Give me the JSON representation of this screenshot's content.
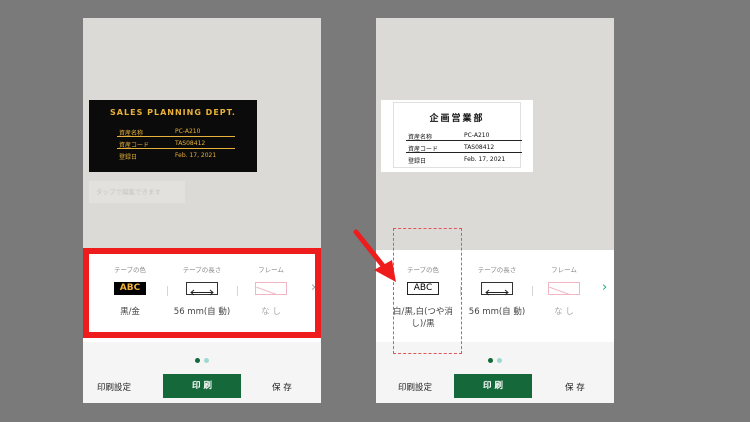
{
  "left": {
    "label": {
      "title": "SALES PLANNING DEPT.",
      "rows": [
        {
          "key": "資産名称",
          "value": "PC-A210"
        },
        {
          "key": "資産コード",
          "value": "TAS08412"
        },
        {
          "key": "登録日",
          "value": "Feb. 17, 2021"
        }
      ]
    },
    "tap_hint": "タップで編集できます",
    "settings": {
      "tape_color": {
        "caption": "テープの色",
        "icon_text": "ABC",
        "value": "黒/金"
      },
      "tape_length": {
        "caption": "テープの長さ",
        "icon": "double-arrow-icon",
        "value": "56 mm(自 動)"
      },
      "frame": {
        "caption": "フレーム",
        "icon": "frame-none-icon",
        "value": "な し"
      }
    },
    "pager": {
      "count": 2,
      "active": 0
    },
    "bottom": {
      "print_settings": "印刷設定",
      "print": "印 刷",
      "save": "保 存"
    }
  },
  "right": {
    "label": {
      "title": "企画営業部",
      "rows": [
        {
          "key": "資産名称",
          "value": "PC-A210"
        },
        {
          "key": "資産コード",
          "value": "TAS08412"
        },
        {
          "key": "登録日",
          "value": "Feb. 17, 2021"
        }
      ]
    },
    "settings": {
      "tape_color": {
        "caption": "テープの色",
        "icon_text": "ABC",
        "value": "白/黒,白(つや消し)/黒"
      },
      "tape_length": {
        "caption": "テープの長さ",
        "icon": "double-arrow-icon",
        "value": "56 mm(自 動)"
      },
      "frame": {
        "caption": "フレーム",
        "icon": "frame-none-icon",
        "value": "な し"
      }
    },
    "pager": {
      "count": 2,
      "active": 0
    },
    "bottom": {
      "print_settings": "印刷設定",
      "print": "印 刷",
      "save": "保 存"
    }
  },
  "colors": {
    "background": "#7a7a7a",
    "accent_green": "#14683a",
    "highlight_red": "#ee1c1c",
    "label_gold": "#e8b13a",
    "dot_active": "#14683a",
    "dot_inactive": "#9fd8d0"
  }
}
